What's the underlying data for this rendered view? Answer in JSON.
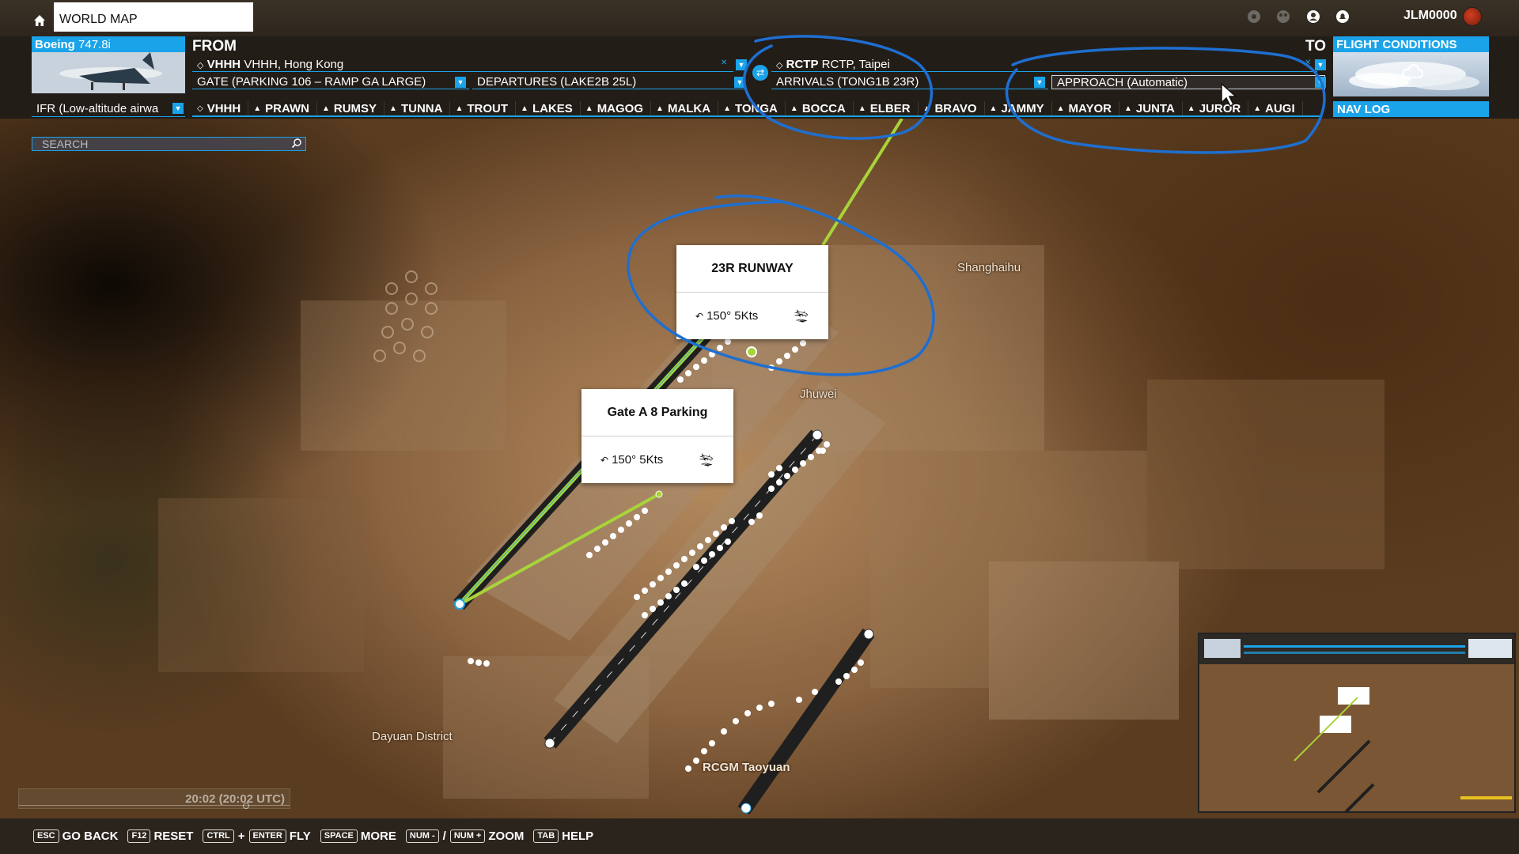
{
  "topbar": {
    "tab_label": "WORLD MAP",
    "username": "JLM0000",
    "icons": [
      "home-icon",
      "activity-icon",
      "group-icon",
      "profile-icon",
      "notification-icon"
    ]
  },
  "aircraft": {
    "name": "Boeing",
    "variant": "747.8i"
  },
  "from": {
    "label": "FROM",
    "airport_code": "VHHH",
    "airport_name": "VHHH, Hong Kong",
    "gate": "GATE (PARKING 106 – RAMP GA LARGE)",
    "departure": "DEPARTURES (LAKE2B 25L)"
  },
  "to": {
    "label": "TO",
    "airport_code": "RCTP",
    "airport_name": "RCTP, Taipei",
    "arrival": "ARRIVALS (TONG1B 23R)",
    "approach": "APPROACH (Automatic)"
  },
  "flight_conditions": {
    "label": "FLIGHT CONDITIONS"
  },
  "flight_type": "IFR (Low-altitude airwa",
  "waypoints": [
    "VHHH",
    "PRAWN",
    "RUMSY",
    "TUNNA",
    "TROUT",
    "LAKES",
    "MAGOG",
    "MALKA",
    "TONGA",
    "BOCCA",
    "ELBER",
    "BRAVO",
    "JAMMY",
    "MAYOR",
    "JUNTA",
    "JUROR",
    "AUGI"
  ],
  "nav_log": "NAV LOG",
  "search": {
    "placeholder": "SEARCH"
  },
  "map": {
    "labels": {
      "shanghaihu": "Shanghaihu",
      "jhuwei": "Jhuwei",
      "dayuan": "Dayuan District",
      "rcgm": "RCGM Taoyuan"
    },
    "runway_card": {
      "title": "23R RUNWAY",
      "wind": "150° 5Kts"
    },
    "gate_card": {
      "title": "Gate A 8 Parking",
      "wind": "150° 5Kts"
    }
  },
  "time": "20:02 (20:02 UTC)",
  "shortcuts": [
    {
      "keys": [
        "ESC"
      ],
      "action": "GO BACK"
    },
    {
      "keys": [
        "F12"
      ],
      "action": "RESET"
    },
    {
      "keys": [
        "CTRL",
        "ENTER"
      ],
      "sep": "+",
      "action": "FLY"
    },
    {
      "keys": [
        "SPACE"
      ],
      "action": "MORE"
    },
    {
      "keys": [
        "NUM -",
        "NUM +"
      ],
      "sep": "/",
      "action": "ZOOM"
    },
    {
      "keys": [
        "TAB"
      ],
      "action": "HELP"
    }
  ],
  "colors": {
    "accent": "#1aa3e8",
    "route": "#a8d43a",
    "annotation": "#1e6fd0"
  }
}
